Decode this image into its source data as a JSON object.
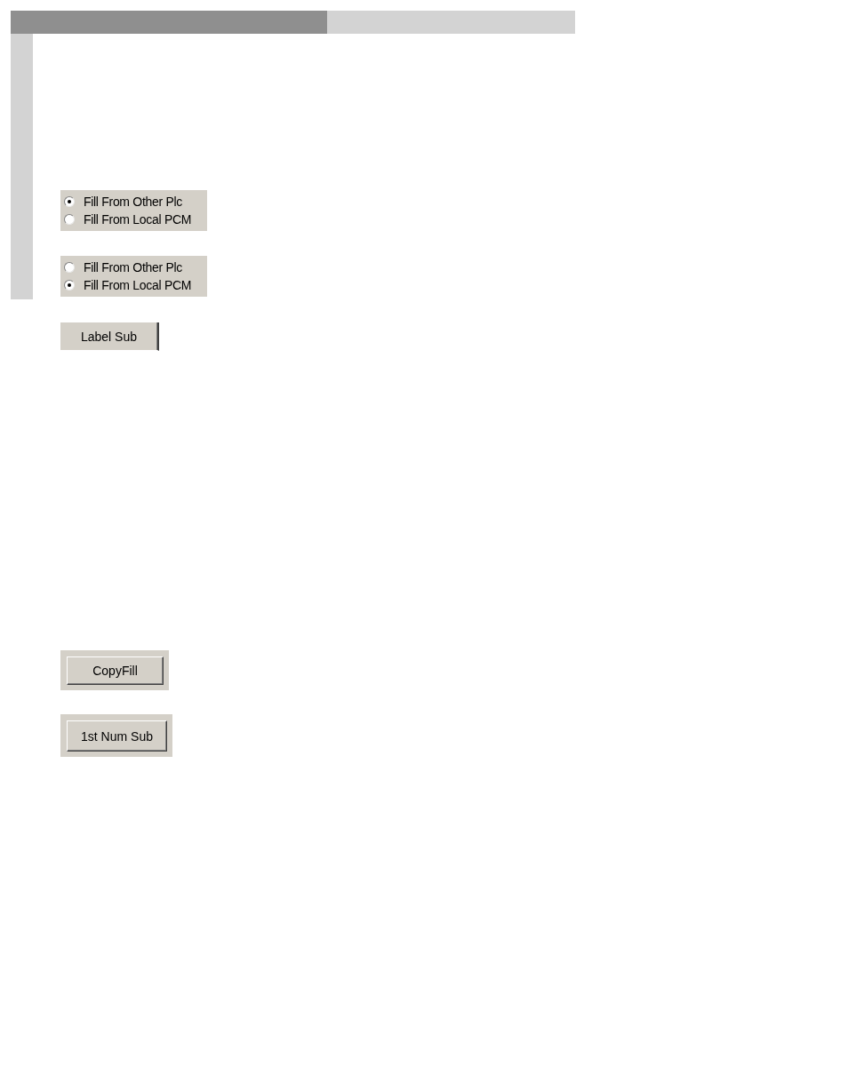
{
  "progress_bar": {
    "level": 0.56
  },
  "radio_groups": [
    {
      "options": [
        {
          "label": "Fill From Other Plc",
          "selected": true
        },
        {
          "label": "Fill From Local PCM",
          "selected": false
        }
      ]
    },
    {
      "options": [
        {
          "label": "Fill From Other Plc",
          "selected": false
        },
        {
          "label": "Fill From Local PCM",
          "selected": true
        }
      ]
    }
  ],
  "buttons": [
    {
      "label": "Label Sub",
      "kind": "plain"
    },
    {
      "label": "CopyFill",
      "kind": "framed"
    },
    {
      "label": "1st Num Sub",
      "kind": "framed"
    }
  ]
}
